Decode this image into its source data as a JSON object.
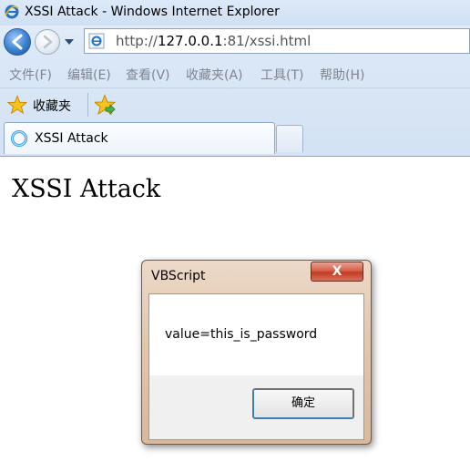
{
  "window": {
    "title": "XSSI Attack - Windows Internet Explorer",
    "address_scheme": "http://",
    "address_host": "127.0.0.1",
    "address_rest": ":81/xssi.html"
  },
  "menu": [
    "文件(F)",
    "编辑(E)",
    "查看(V)",
    "收藏夹(A)",
    "工具(T)",
    "帮助(H)"
  ],
  "favorites": {
    "label": "收藏夹"
  },
  "tabs": [
    {
      "label": "XSSI Attack"
    }
  ],
  "page": {
    "heading": "XSSI Attack"
  },
  "dialog": {
    "title": "VBScript",
    "close_label": "X",
    "message": "value=this_is_password",
    "ok_label": "确定"
  },
  "icons": {
    "title": "ie-logo-icon",
    "back": "back-arrow-icon",
    "forward": "forward-arrow-icon",
    "address": "ie-page-icon",
    "favorites": "star-icon",
    "add_favorites": "add-favorite-star-icon",
    "tab": "loading-ring-icon"
  },
  "colors": {
    "chrome": "#d3e2f4",
    "dialog_frame": "#e2c6ae",
    "close_button": "#c13b22",
    "back_button": "#3a7fd0"
  }
}
